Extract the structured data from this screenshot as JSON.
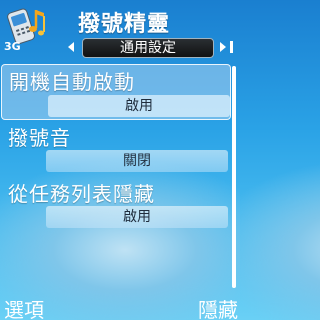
{
  "titlebar": {
    "app_title": "撥號精靈",
    "network_indicator": "3G",
    "icon": "phone-music-icon"
  },
  "tabs": {
    "current": "通用設定",
    "left_arrow_icon": "arrow-left-icon",
    "right_arrow_icon": "arrow-right-icon"
  },
  "settings": {
    "items": [
      {
        "label": "開機自動啟動",
        "value": "啟用",
        "selected": true
      },
      {
        "label": "撥號音",
        "value": "關閉",
        "selected": false
      },
      {
        "label": "從任務列表隱藏",
        "value": "啟用",
        "selected": false
      }
    ]
  },
  "softkeys": {
    "left": "選項",
    "right": "隱藏"
  },
  "colors": {
    "background_top": "#1a7fd0",
    "background_bottom": "#6ad0f5",
    "selected_item": "#aad2f0"
  }
}
